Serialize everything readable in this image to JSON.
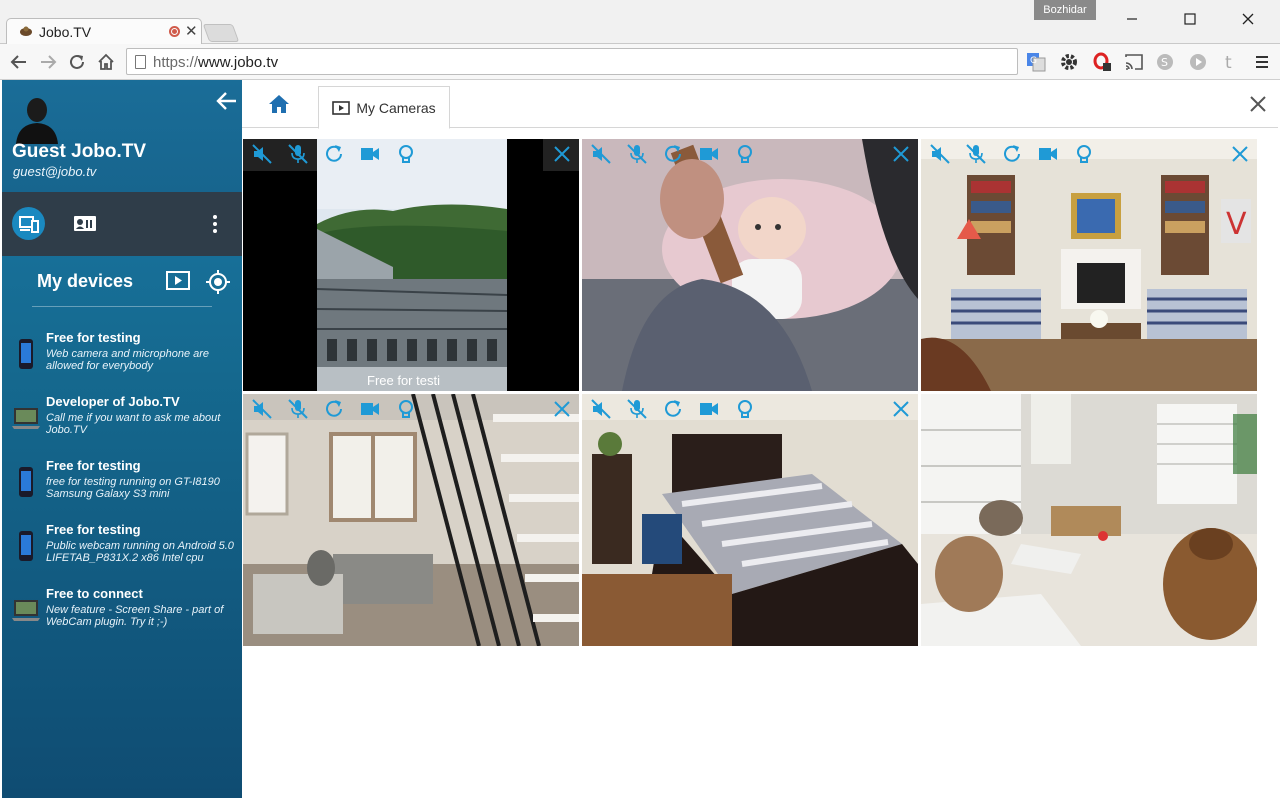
{
  "browser": {
    "tab_title": "Jobo.TV",
    "profile_name": "Bozhidar",
    "url_scheme": "https://",
    "url_host": "www.jobo.tv"
  },
  "colors": {
    "accent": "#1a89c0",
    "sidebar_top": "#1b79a6",
    "sidebar_bottom": "#0f4c72",
    "control_icon": "#1f9ad6"
  },
  "user": {
    "name": "Guest Jobo.TV",
    "email": "guest@jobo.tv"
  },
  "sidebar": {
    "section_title": "My devices",
    "devices": [
      {
        "icon": "phone-icon",
        "title": "Free for testing",
        "desc": "Web camera and microphone are allowed for everybody"
      },
      {
        "icon": "laptop-icon",
        "title": "Developer of Jobo.TV",
        "desc": "Call me if you want to ask me about Jobo.TV"
      },
      {
        "icon": "phone-icon",
        "title": "Free for testing",
        "desc": "free for testing running on GT-I8190 Samsung Galaxy S3 mini"
      },
      {
        "icon": "phone-icon",
        "title": "Free for testing",
        "desc": "Public webcam running on Android 5.0 LIFETAB_P831X.2 x86 Intel cpu"
      },
      {
        "icon": "laptop-icon",
        "title": "Free to connect",
        "desc": "New feature - Screen Share - part of WebCam plugin. Try it ;-)"
      }
    ]
  },
  "main": {
    "tabs": [
      {
        "label": "My Cameras"
      }
    ],
    "cameras": [
      {
        "scene": "outdoor-building",
        "overlay_label": "Free for testi"
      },
      {
        "scene": "baby"
      },
      {
        "scene": "living-room"
      },
      {
        "scene": "stairs-room"
      },
      {
        "scene": "bedroom"
      },
      {
        "scene": "dogs"
      }
    ]
  }
}
